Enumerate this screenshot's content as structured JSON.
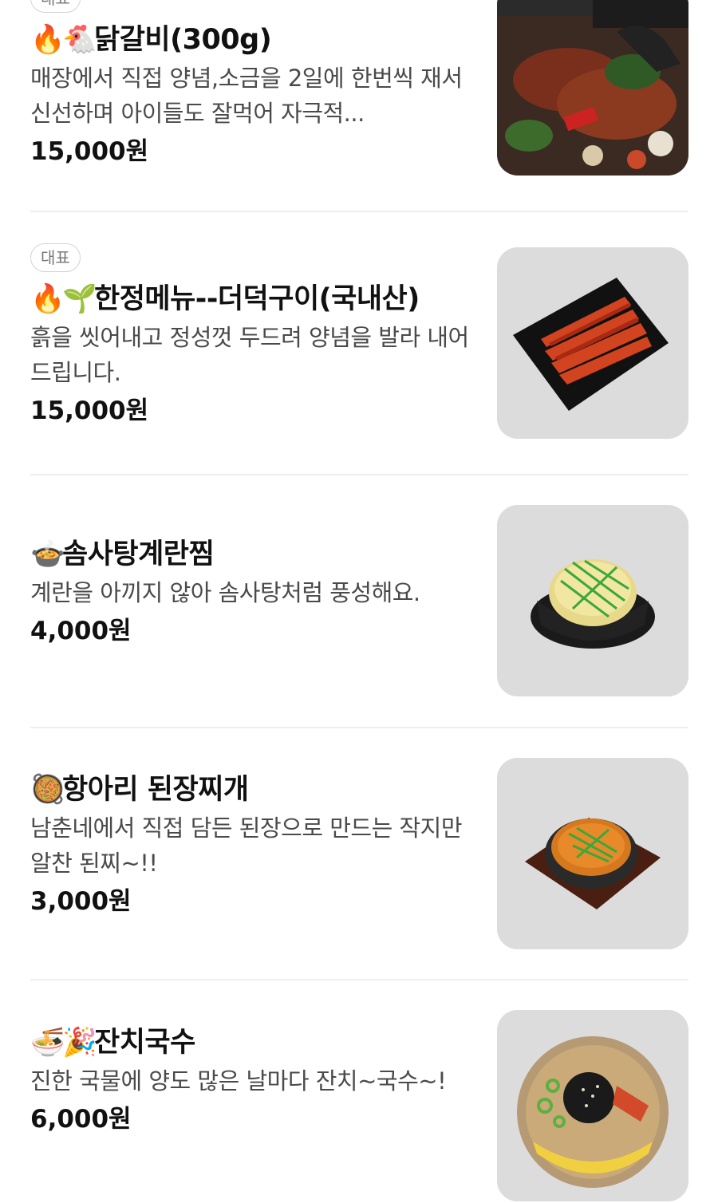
{
  "menu_items": [
    {
      "badge": "대표",
      "emoji": [
        "🔥",
        "🐔"
      ],
      "name": "닭갈비(300g)",
      "description": "매장에서 직접 양념,소금을 2일에 한번씩 재서 신선하며 아이들도 잘먹어 자극적...",
      "price": "15,000원",
      "image": "grilled-chicken-table-photo"
    },
    {
      "badge": "대표",
      "emoji": [
        "🔥",
        "🌱"
      ],
      "name": "한정메뉴--더덕구이(국내산)",
      "description": "흙을 씻어내고 정성껏 두드려 양념을 발라 내어드립니다.",
      "price": "15,000원",
      "image": "grilled-deodeok-photo"
    },
    {
      "emoji": [
        "🍲"
      ],
      "name": "솜사탕계란찜",
      "description": "계란을 아끼지 않아 솜사탕처럼 풍성해요.",
      "price": "4,000원",
      "image": "steamed-egg-photo"
    },
    {
      "emoji": [
        "🥘"
      ],
      "name": "항아리 된장찌개",
      "description": "남춘네에서 직접 담든 된장으로 만드는 작지만 알찬 된찌~!!",
      "price": "3,000원",
      "image": "doenjang-stew-photo"
    },
    {
      "emoji": [
        "🍜",
        "🎉"
      ],
      "name": "잔치국수",
      "description": "진한 국물에 양도 많은 날마다 잔치~국수~!",
      "price": "6,000원",
      "image": "banquet-noodles-photo"
    }
  ]
}
